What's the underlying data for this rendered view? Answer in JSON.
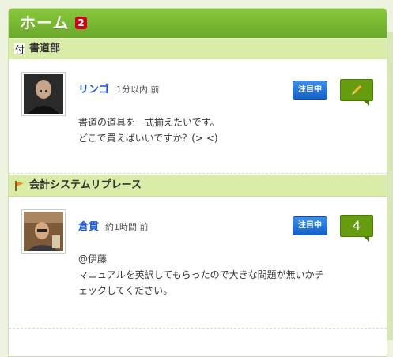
{
  "header": {
    "title": "ホーム",
    "badge": "2"
  },
  "posts": [
    {
      "section": "書道部",
      "section_icon": "calligraphy-icon",
      "user": "リンゴ",
      "time": "1分以内 前",
      "attention_label": "注目中",
      "bubble_icon": "pencil-icon",
      "body_lines": [
        "書道の道具を一式揃えたいです。",
        "どこで買えばいいですか？(> <)"
      ]
    },
    {
      "section": "会計システムリプレース",
      "section_icon": "flag-icon",
      "user": "倉貫",
      "time": "約1時間 前",
      "attention_label": "注目中",
      "bubble_count": "4",
      "body_lines": [
        "@伊藤",
        "マニュアルを英訳してもらったので大きな問題が無いかチ",
        "ェックしてください。"
      ]
    }
  ],
  "colors": {
    "header_green": "#7ab934",
    "section_bg": "#d9eca8",
    "name_blue": "#1a55d8",
    "attention_blue": "#1f73d6",
    "bubble_green": "#669c10",
    "badge_red": "#d0021b"
  }
}
